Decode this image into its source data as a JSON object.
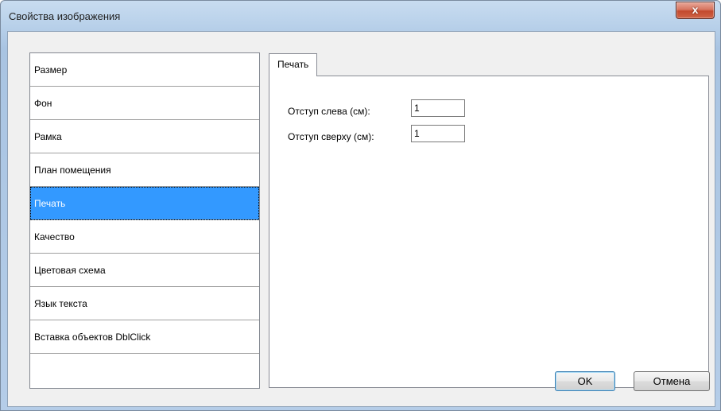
{
  "window": {
    "title": "Свойства изображения",
    "close_label": "x"
  },
  "sidebar": {
    "items": [
      {
        "label": "Размер"
      },
      {
        "label": "Фон"
      },
      {
        "label": "Рамка"
      },
      {
        "label": "План помещения"
      },
      {
        "label": "Печать",
        "selected": true
      },
      {
        "label": "Качество"
      },
      {
        "label": "Цветовая схема"
      },
      {
        "label": "Язык текста"
      },
      {
        "label": "Вставка объектов DblClick"
      }
    ]
  },
  "tabs": [
    {
      "label": "Печать",
      "active": true
    }
  ],
  "panel": {
    "fields": [
      {
        "label": "Отступ слева (см):",
        "value": "1"
      },
      {
        "label": "Отступ сверху (см):",
        "value": "1"
      }
    ]
  },
  "buttons": {
    "ok_label": "OK",
    "cancel_label": "Отмена"
  },
  "colors": {
    "selection": "#3399ff",
    "close_button": "#c34a2e"
  }
}
